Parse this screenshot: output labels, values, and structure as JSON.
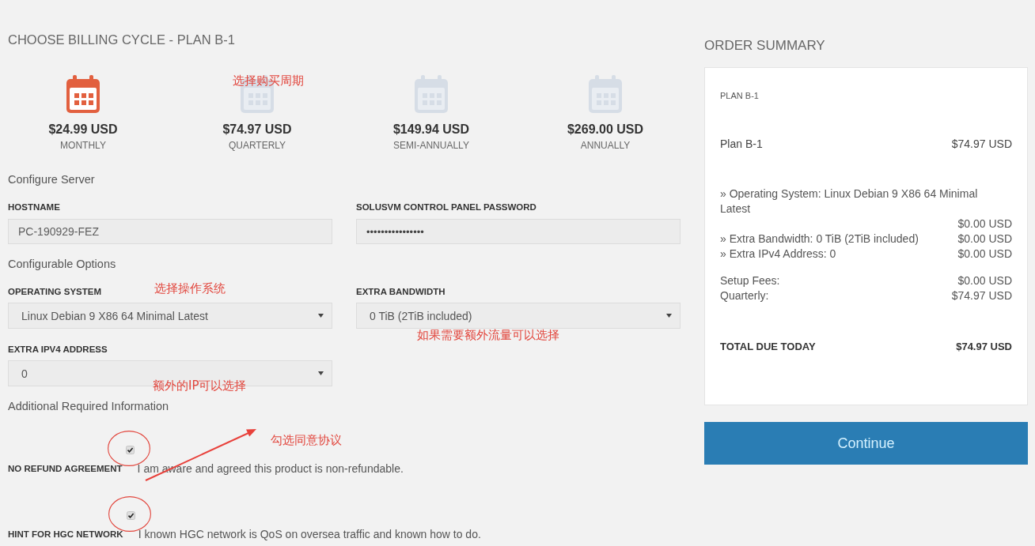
{
  "billing_cycle": {
    "title": "CHOOSE BILLING CYCLE - PLAN B-1",
    "annotation": "选择购买周期",
    "options": [
      {
        "price": "$24.99 USD",
        "period": "MONTHLY",
        "selected": true
      },
      {
        "price": "$74.97 USD",
        "period": "QUARTERLY",
        "selected": false
      },
      {
        "price": "$149.94 USD",
        "period": "SEMI-ANNUALLY",
        "selected": false
      },
      {
        "price": "$269.00 USD",
        "period": "ANNUALLY",
        "selected": false
      }
    ]
  },
  "configure_server": {
    "heading": "Configure Server",
    "fields": [
      {
        "kind": "text",
        "label": "HOSTNAME",
        "value": "PC-190929-FEZ"
      },
      {
        "kind": "password",
        "label": "SOLUSVM CONTROL PANEL PASSWORD",
        "value": "••••••••••••••••"
      }
    ]
  },
  "configurable_options": {
    "heading": "Configurable Options",
    "fields": [
      {
        "label": "OPERATING SYSTEM",
        "value": "Linux Debian 9 X86 64 Minimal Latest",
        "annotation": "选择操作系统"
      },
      {
        "label": "EXTRA BANDWIDTH",
        "value": "0 TiB (2TiB included)",
        "annotation": "如果需要额外流量可以选择"
      },
      {
        "label": "EXTRA IPV4 ADDRESS",
        "value": "0",
        "annotation": "额外的IP可以选择"
      }
    ]
  },
  "additional_info": {
    "heading": "Additional Required Information",
    "annotation": "勾选同意协议",
    "agreements": [
      {
        "label": "NO REFUND AGREEMENT",
        "text": "I am aware and agreed this product is non-refundable.",
        "checked": true,
        "circled": true
      },
      {
        "label": "HINT FOR HGC NETWORK",
        "text": "I known HGC network is QoS on oversea traffic and known how to do.",
        "checked": true,
        "circled": true
      }
    ]
  },
  "order_summary": {
    "title": "ORDER SUMMARY",
    "plan_heading": "PLAN B-1",
    "product": {
      "name": "Plan B-1",
      "price": "$74.97 USD"
    },
    "options": [
      {
        "text": "» Operating System: Linux Debian 9 X86 64 Minimal Latest",
        "price": "$0.00 USD"
      },
      {
        "text": "» Extra Bandwidth: 0 TiB (2TiB included)",
        "price": "$0.00 USD"
      },
      {
        "text": "» Extra IPv4 Address: 0",
        "price": "$0.00 USD"
      }
    ],
    "fees": [
      {
        "label": "Setup Fees:",
        "amount": "$0.00 USD"
      },
      {
        "label": "Quarterly:",
        "amount": "$74.97 USD"
      }
    ],
    "total": {
      "label": "TOTAL DUE TODAY",
      "amount": "$74.97 USD"
    },
    "button": "Continue"
  }
}
